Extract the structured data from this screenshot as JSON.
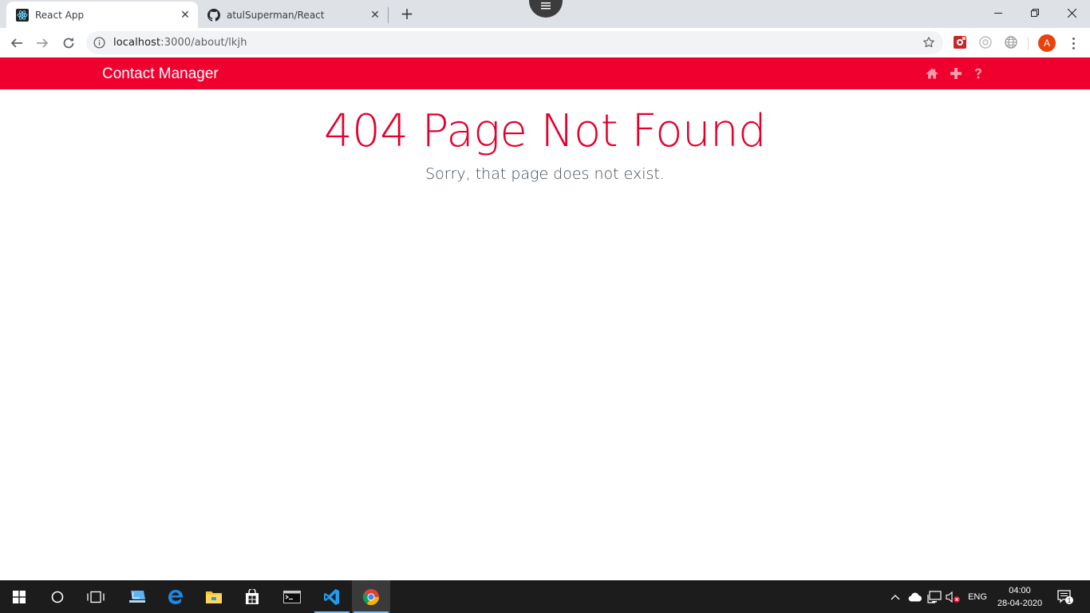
{
  "browser": {
    "tabs": [
      {
        "title": "React App",
        "favicon": "react-icon",
        "active": true
      },
      {
        "title": "atulSuperman/React",
        "favicon": "github-icon",
        "active": false
      }
    ],
    "address": {
      "host": "localhost",
      "path": ":3000/about/lkjh"
    },
    "profile_initial": "A",
    "extensions": [
      "extension-red-icon",
      "extension-target-icon",
      "extension-globe-icon"
    ]
  },
  "app": {
    "brand": "Contact Manager",
    "nav_icons": [
      "home-icon",
      "plus-icon",
      "question-icon"
    ],
    "accent_color": "#f0002e"
  },
  "content": {
    "title": "404 Page Not Found",
    "subtitle": "Sorry, that page does not exist."
  },
  "taskbar": {
    "apps": [
      "windows-start-icon",
      "cortana-search-icon",
      "task-view-icon",
      "this-pc-icon",
      "edge-icon",
      "file-explorer-icon",
      "store-icon",
      "terminal-icon",
      "vscode-icon",
      "chrome-icon"
    ],
    "language": "ENG",
    "time": "04:00",
    "date": "28-04-2020",
    "notification_count": "1"
  }
}
